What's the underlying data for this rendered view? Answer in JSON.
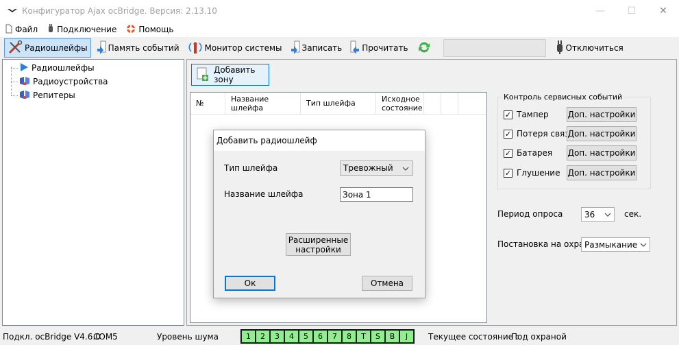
{
  "window": {
    "title": "Конфигуратор Ajax ocBridge. Версия: 2.13.10"
  },
  "menu": {
    "file": "Файл",
    "connection": "Подключение",
    "help": "Помощь"
  },
  "toolbar": {
    "radio_loops": "Радиошлейфы",
    "event_memory": "Память событий",
    "system_monitor": "Монитор системы",
    "write": "Записать",
    "read": "Прочитать",
    "disconnect": "Отключиться"
  },
  "tree": {
    "items": [
      "Радиошлейфы",
      "Радиоустройства",
      "Репитеры"
    ]
  },
  "main": {
    "add_zone": "Добавить зону",
    "columns": [
      "№",
      "Название шлейфа",
      "Тип шлейфа",
      "Исходное состояние"
    ],
    "service_group_title": "Контроль сервисных событий",
    "service_events": [
      {
        "label": "Тампер",
        "checked": true,
        "button": "Доп. настройки"
      },
      {
        "label": "Потеря связи",
        "checked": true,
        "button": "Доп. настройки"
      },
      {
        "label": "Батарея",
        "checked": true,
        "button": "Доп. настройки"
      },
      {
        "label": "Глушение",
        "checked": true,
        "button": "Доп. настройки"
      }
    ],
    "poll_period_label": "Период опроса",
    "poll_period_value": "36",
    "poll_period_unit": "сек.",
    "arming_label": "Постановка на охрану",
    "arming_value": "Размыкание"
  },
  "dialog": {
    "title": "Добавить радиошлейф",
    "type_label": "Тип шлейфа",
    "type_value": "Тревожный",
    "name_label": "Название шлейфа",
    "name_value": "Зона 1",
    "advanced_line1": "Расширенные",
    "advanced_line2": "настройки",
    "ok": "Ок",
    "cancel": "Отмена"
  },
  "status": {
    "connected": "Подкл. ocBridge V4.6.0",
    "port": "COM5",
    "noise_label": "Уровень шума",
    "noise_cells": [
      "1",
      "2",
      "3",
      "4",
      "5",
      "6",
      "7",
      "8",
      "T",
      "S",
      "B",
      "J"
    ],
    "state_label": "Текущее состояние :",
    "state_value": "Под охраной"
  },
  "colors": {
    "accent": "#0078d7",
    "noise_green": "#90ee90",
    "active_tool": "#cce4f7"
  }
}
